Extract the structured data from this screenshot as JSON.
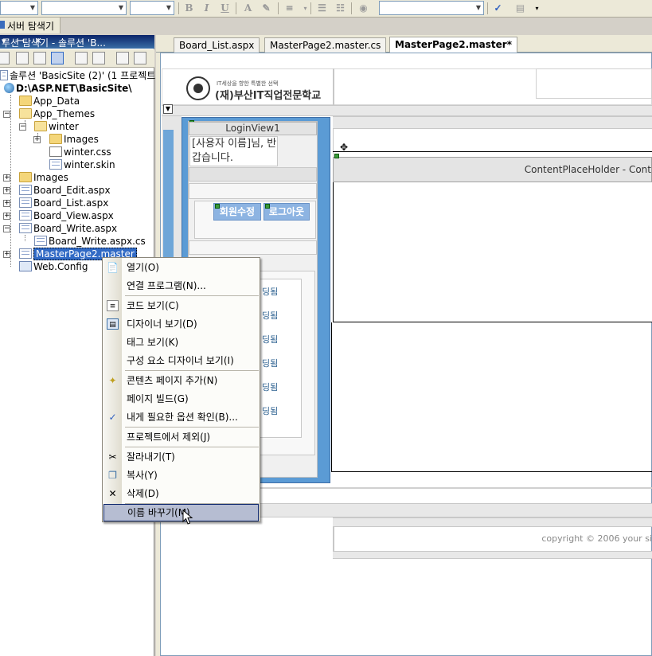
{
  "toolbar": {
    "format_buttons": [
      "B",
      "I",
      "U",
      "A"
    ]
  },
  "server_explorer_tab": {
    "label": "서버 탐색기"
  },
  "solution_explorer": {
    "title": "루션 탐색기 - 솔루션 'B...",
    "title_buttons": "▾ ꟷ ✕",
    "tree": [
      {
        "label": "솔루션 'BasicSite (2)' (1 프로젝트)"
      },
      {
        "label": "D:\\ASP.NET\\BasicSite\\"
      },
      {
        "label": "App_Data"
      },
      {
        "label": "App_Themes"
      },
      {
        "label": "winter"
      },
      {
        "label": "Images"
      },
      {
        "label": "winter.css"
      },
      {
        "label": "winter.skin"
      },
      {
        "label": "Images"
      },
      {
        "label": "Board_Edit.aspx"
      },
      {
        "label": "Board_List.aspx"
      },
      {
        "label": "Board_View.aspx"
      },
      {
        "label": "Board_Write.aspx"
      },
      {
        "label": "Board_Write.aspx.cs"
      },
      {
        "label": "MasterPage2.master"
      },
      {
        "label": "Web.Config"
      }
    ]
  },
  "document_tabs": [
    {
      "label": "Board_List.aspx"
    },
    {
      "label": "MasterPage2.master.cs"
    },
    {
      "label": "MasterPage2.master*"
    }
  ],
  "design": {
    "logo_title": "(재)부산IT직업전문학교",
    "logo_subtitle": "IT세상을 향한 특별한 선택",
    "login_view_title": "LoginView1",
    "greeting": "[사용자 이름]님, 반갑습니다.",
    "edit_member_button": "회원수정",
    "logout_button": "로그아웃",
    "menu_items": [
      "딩됨",
      "딩됨",
      "딩됨",
      "딩됨",
      "딩됨",
      "딩됨"
    ],
    "content_placeholder_label": "ContentPlaceHolder - Cont",
    "copyright": "copyright © 2006 your si"
  },
  "context_menu": {
    "items": [
      {
        "label": "열기(O)",
        "icon": "open-icon"
      },
      {
        "label": "연결 프로그램(N)...",
        "icon": ""
      },
      {
        "label": "코드 보기(C)",
        "icon": "code-view-icon"
      },
      {
        "label": "디자이너 보기(D)",
        "icon": "designer-view-icon"
      },
      {
        "label": "태그 보기(K)",
        "icon": ""
      },
      {
        "label": "구성 요소 디자이너 보기(I)",
        "icon": ""
      },
      {
        "label": "콘텐츠 페이지 추가(N)",
        "icon": "add-content-page-icon"
      },
      {
        "label": "페이지 빌드(G)",
        "icon": ""
      },
      {
        "label": "내게 필요한 옵션 확인(B)...",
        "icon": "accessibility-check-icon"
      },
      {
        "label": "프로젝트에서 제외(J)",
        "icon": ""
      },
      {
        "label": "잘라내기(T)",
        "icon": "cut-icon"
      },
      {
        "label": "복사(Y)",
        "icon": "copy-icon"
      },
      {
        "label": "삭제(D)",
        "icon": "delete-icon"
      },
      {
        "label": "이름 바꾸기(M)",
        "icon": ""
      }
    ],
    "highlighted_index": 13
  },
  "colors": {
    "title_bar": "#0a246a",
    "selection": "#316ac5",
    "login_box": "#5b9bd5",
    "menu_highlight": "#b6bdd2"
  }
}
